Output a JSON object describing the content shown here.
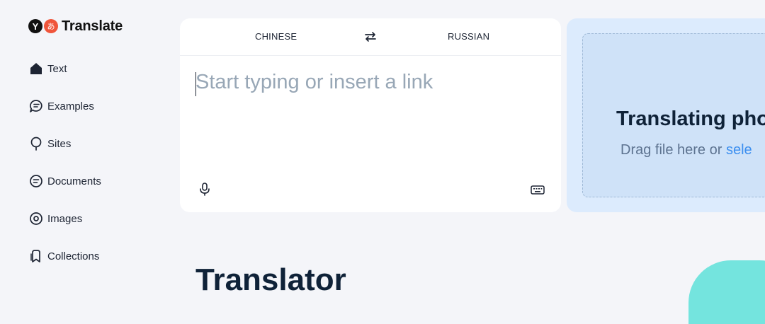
{
  "brand": {
    "logo_letter": "Y",
    "logo_glyph": "あ",
    "name": "Translate"
  },
  "sidebar": {
    "items": [
      {
        "label": "Text",
        "icon": "text-home-icon"
      },
      {
        "label": "Examples",
        "icon": "examples-chat-icon"
      },
      {
        "label": "Sites",
        "icon": "sites-pin-icon"
      },
      {
        "label": "Documents",
        "icon": "documents-icon"
      },
      {
        "label": "Images",
        "icon": "images-camera-icon"
      },
      {
        "label": "Collections",
        "icon": "collections-bookmark-icon"
      }
    ]
  },
  "translator": {
    "source_lang": "CHINESE",
    "target_lang": "RUSSIAN",
    "input_value": "",
    "placeholder": "Start typing or insert a link"
  },
  "photo": {
    "title": "Translating phot",
    "subtitle_prefix": "Drag file here or ",
    "subtitle_link": "sele"
  },
  "page": {
    "heading": "Translator"
  },
  "colors": {
    "background": "#f4f5f9",
    "accent": "#3c8ff0",
    "photo_panel": "#dcebfd",
    "decor": "#74e4de"
  }
}
